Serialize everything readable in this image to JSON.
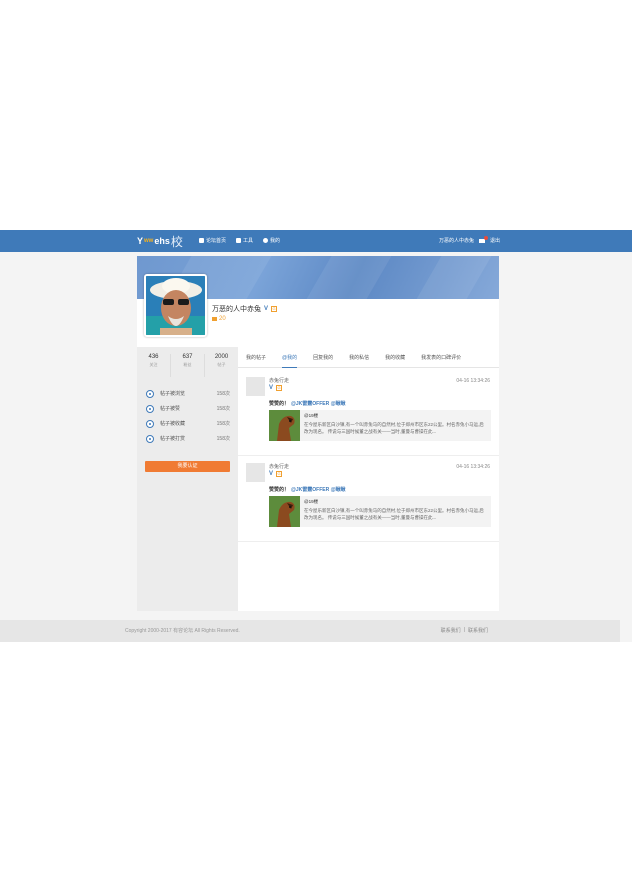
{
  "nav": {
    "logo_y": "Y",
    "logo_accent": "ww",
    "logo_text": "ehs",
    "logo_han": "校",
    "items": [
      {
        "label": "论坛首页",
        "icon": "forum-icon"
      },
      {
        "label": "工具",
        "icon": "grid-icon"
      },
      {
        "label": "我的",
        "icon": "user-icon"
      }
    ],
    "username": "万恶的人中赤兔",
    "logout": "退出",
    "mail_icon": "mail-icon"
  },
  "profile": {
    "name": "万恶的人中赤兔",
    "verified": "V",
    "level_badge": "G",
    "coins": "20"
  },
  "stats": [
    {
      "value": "436",
      "label": "关注"
    },
    {
      "value": "637",
      "label": "粉丝"
    },
    {
      "value": "2000",
      "label": "帖子"
    }
  ],
  "metrics": [
    {
      "label": "帖子被浏览",
      "value": "158次",
      "icon": "eye-icon"
    },
    {
      "label": "帖子被赞",
      "value": "158次",
      "icon": "thumb-up-icon"
    },
    {
      "label": "帖子被收藏",
      "value": "158次",
      "icon": "star-icon"
    },
    {
      "label": "帖子被打赏",
      "value": "158次",
      "icon": "reward-icon"
    }
  ],
  "cert_button": "我要认证",
  "tabs": [
    "我的帖子",
    "@我的",
    "回复我的",
    "我的私信",
    "我的收藏",
    "我发表的口碑评价"
  ],
  "active_tab": 1,
  "posts": [
    {
      "author": "赤兔行走",
      "time": "04-16 13:34:26",
      "title": "赞赞的！",
      "mentions": "@JK雷霆OFFER @瞅瞅",
      "quote_author": "@19楼",
      "quote_text": "在今屋乐新区白沙镇,有一个叫赤兔马的自然村,位于郑州市区东22公里。村名赤兔小马运,后改为现名。 传说与三国时候董之战有关——当时,董曼与曹操在此..."
    },
    {
      "author": "赤兔行走",
      "time": "04-16 13:34:26",
      "title": "赞赞的！",
      "mentions": "@JK雷霆OFFER @瞅瞅",
      "quote_author": "@19楼",
      "quote_text": "在今屋乐新区白沙镇,有一个叫赤兔马的自然村,位于郑州市区东22公里。村名赤兔小马运,后改为现名。 传说与三国时候董之战有关——当时,董曼与曹操在此..."
    }
  ],
  "footer": {
    "copyright": "Copyright 2000-2017 有容论坛 All Rights Reserved.",
    "links": [
      "联系我们",
      "|",
      "联系我们"
    ]
  },
  "colors": {
    "nav_bg": "#3f7ab9",
    "accent_orange": "#f07b33",
    "link_blue": "#3f7ab9"
  }
}
